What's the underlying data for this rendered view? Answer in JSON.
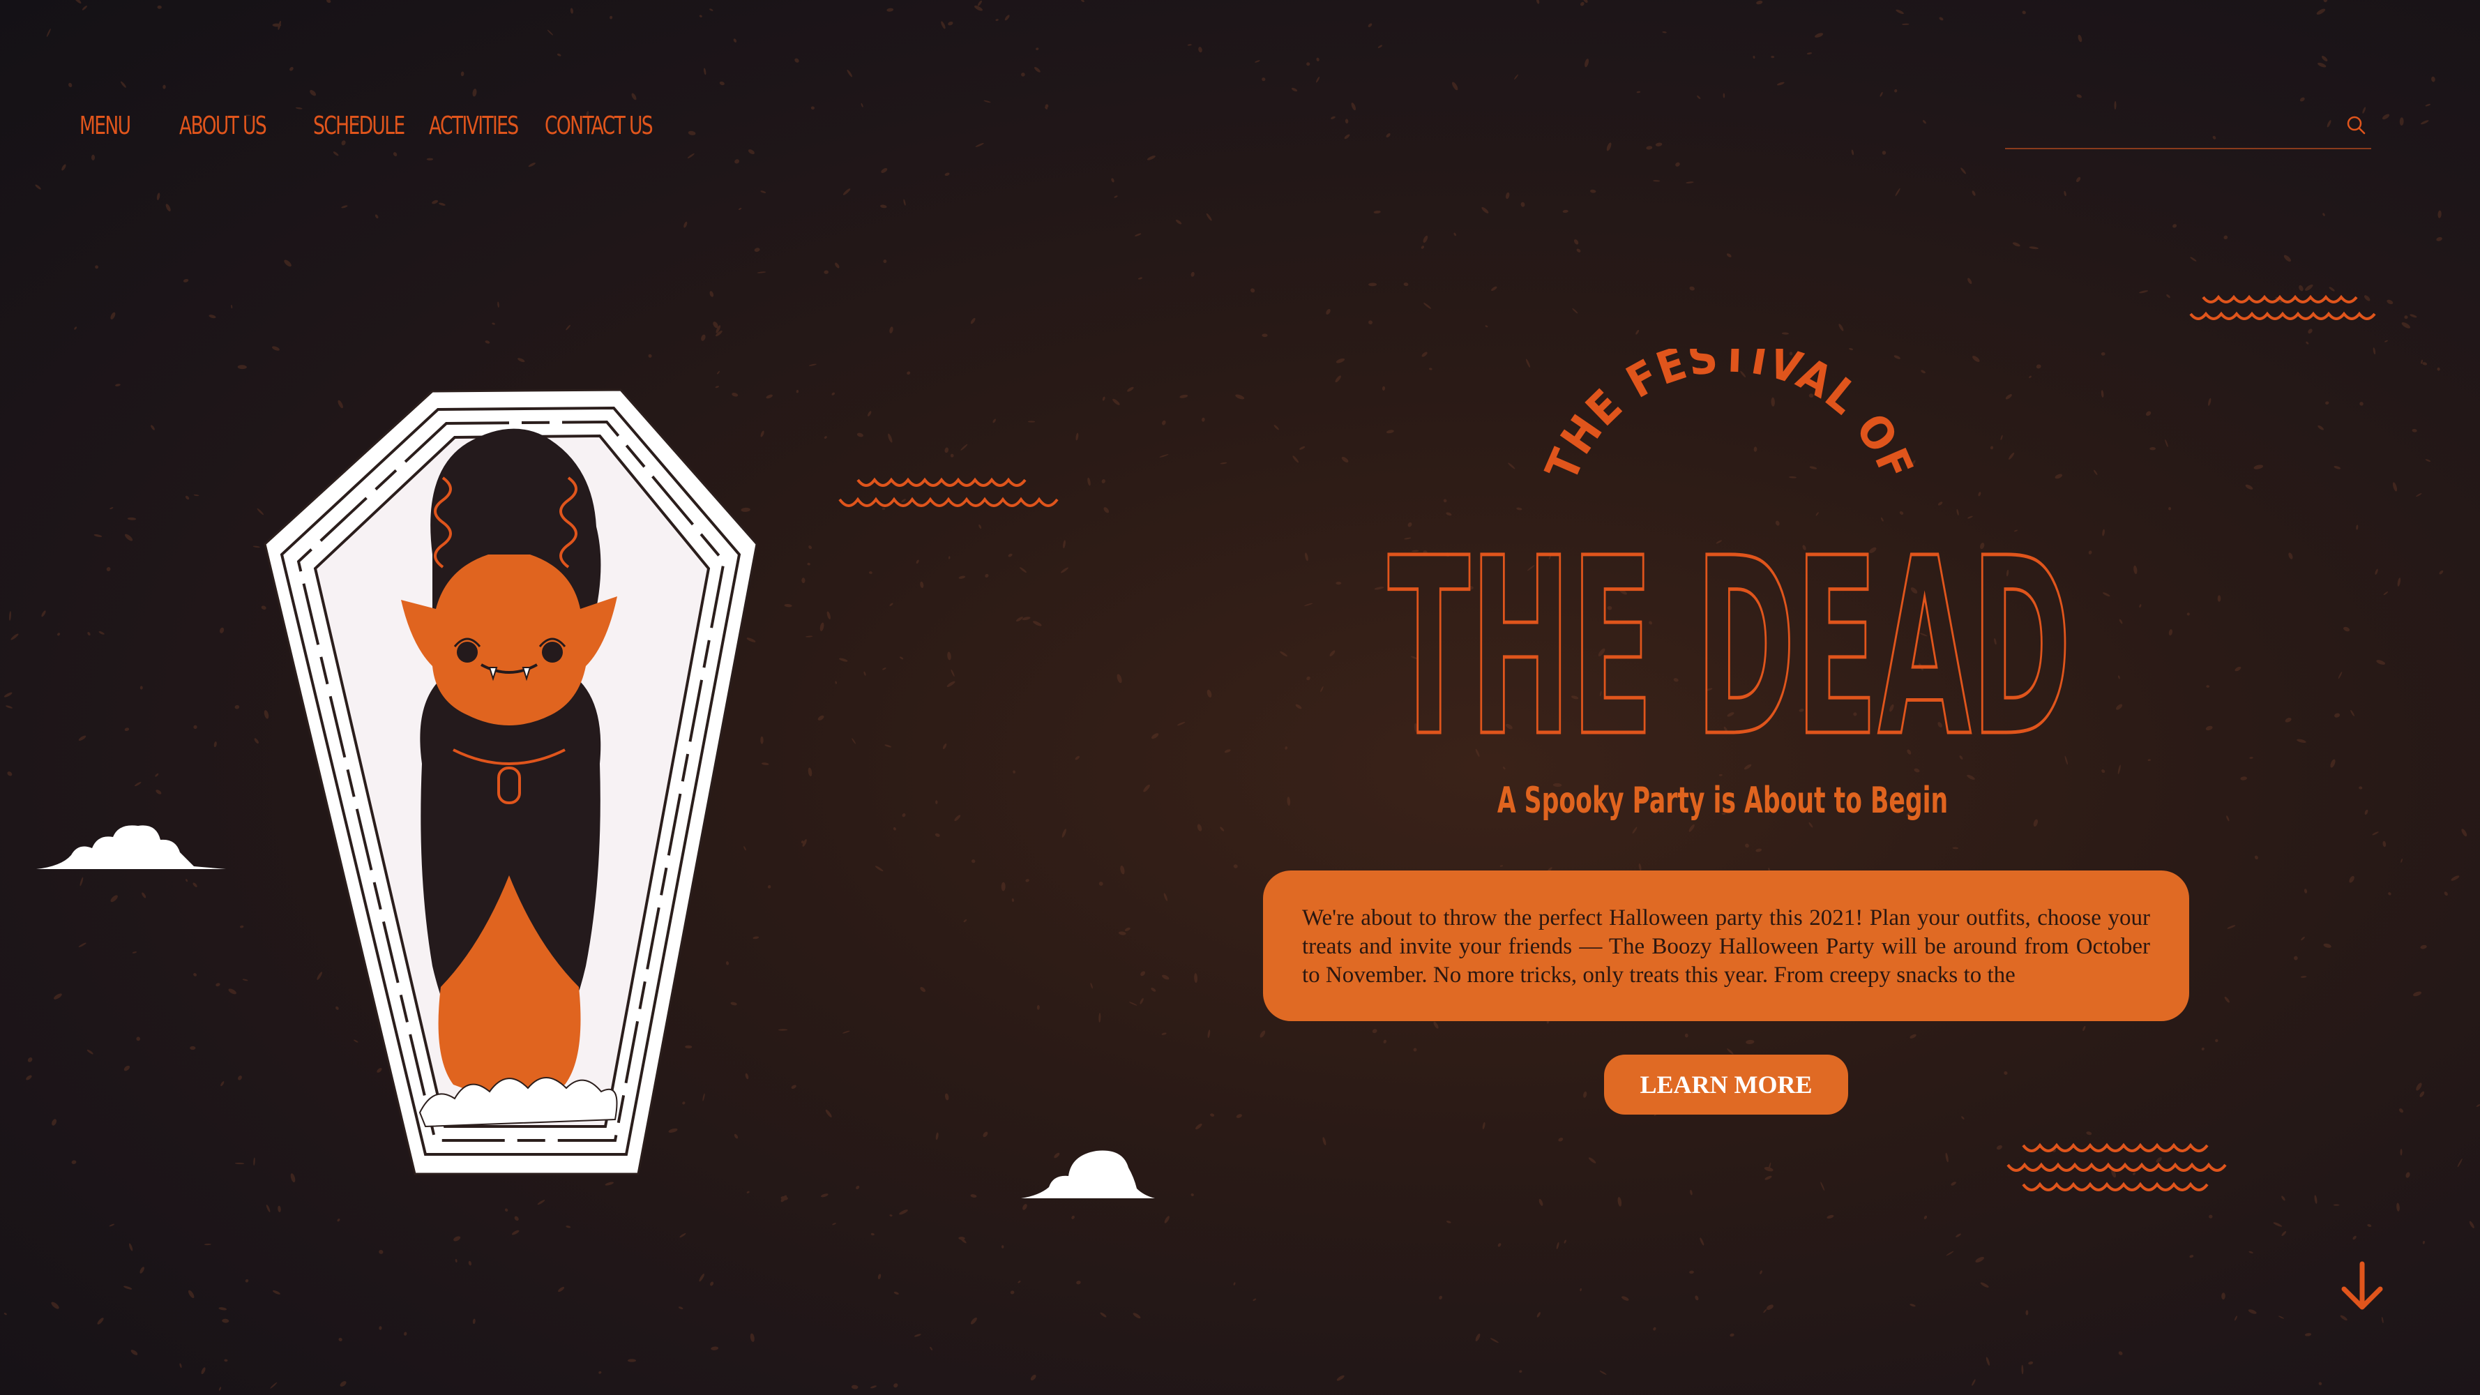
{
  "nav": {
    "items": [
      {
        "label": "Menu"
      },
      {
        "label": "About Us"
      },
      {
        "label": "Schedule"
      },
      {
        "label": "Activities"
      },
      {
        "label": "Contact Us"
      }
    ]
  },
  "search": {
    "value": "",
    "placeholder": "",
    "icon": "search-icon"
  },
  "hero": {
    "arc_title": "THE FESTIVAL OF",
    "title": "THE DEAD",
    "subtitle": "A Spooky Party is About to Begin",
    "description": "We're about to throw the perfect Halloween party this 2021! Plan your outfits, choose your treats and invite your friends — The Boozy Halloween Party will be around from October to November. No more tricks, only treats this year. From creepy snacks to the",
    "cta_label": "LEARN MORE"
  },
  "colors": {
    "accent": "#e0551c",
    "box": "#e06a24",
    "background": "#1d1518",
    "cloud": "#ffffff"
  }
}
